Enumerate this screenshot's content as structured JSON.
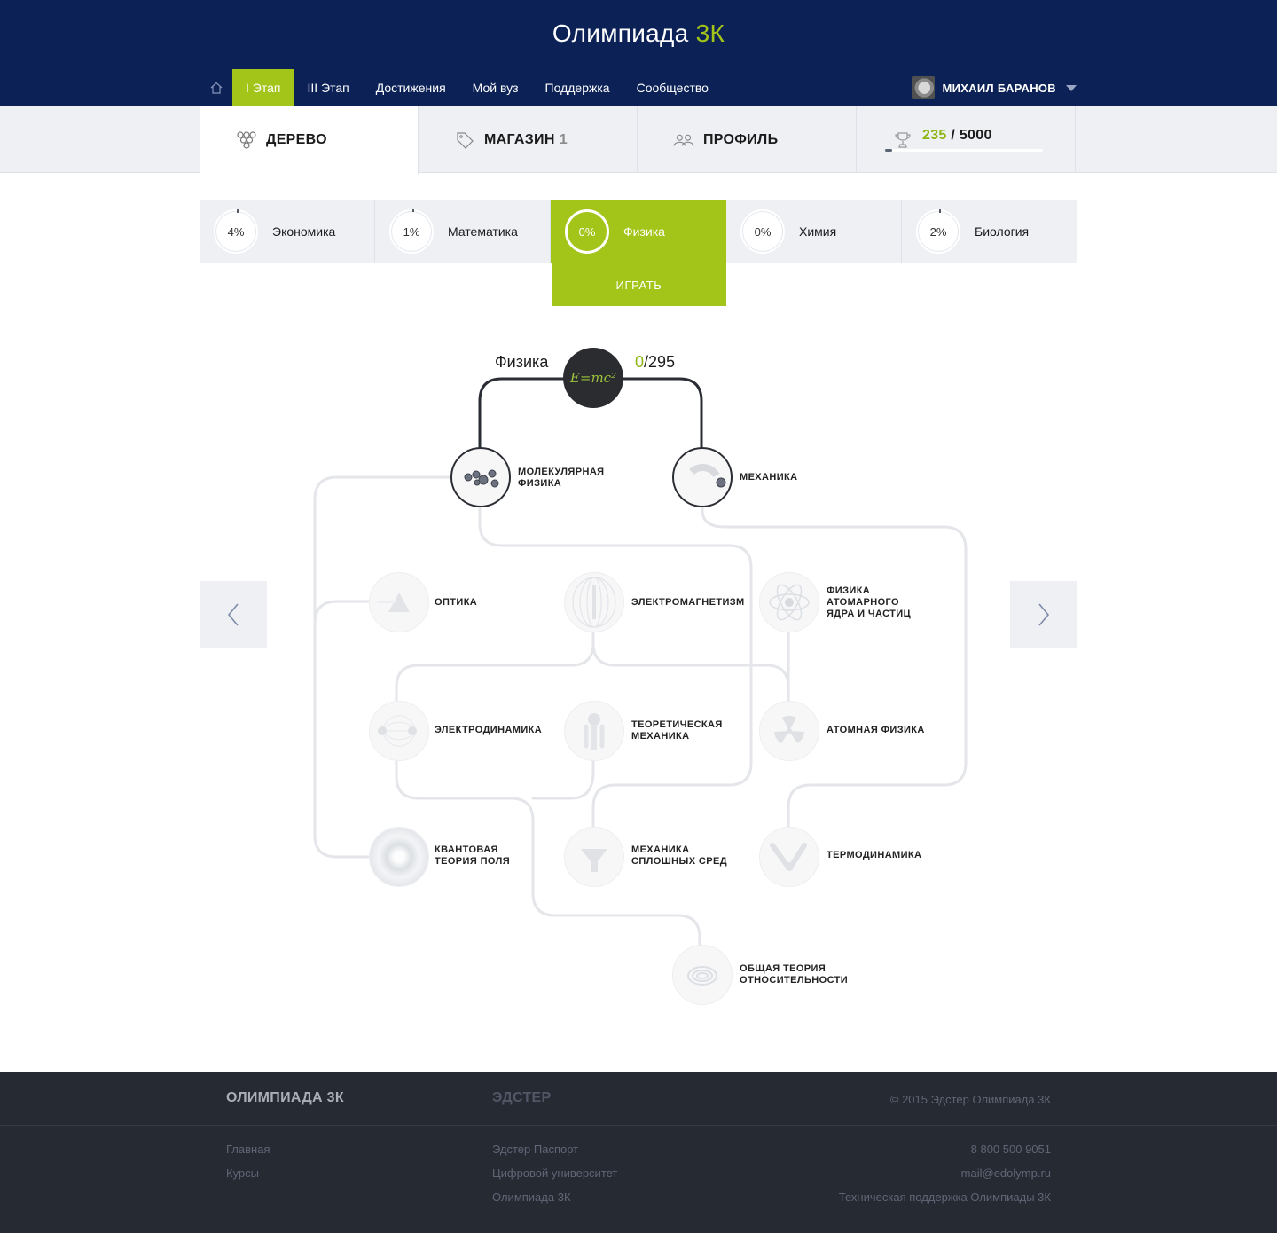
{
  "header": {
    "brand_main": "Олимпиада",
    "brand_accent": "3К",
    "nav": [
      "I Этап",
      "III Этап",
      "Достижения",
      "Мой вуз",
      "Поддержка",
      "Сообщество"
    ],
    "user_name": "МИХАИЛ БАРАНОВ"
  },
  "tabs": {
    "tree": "ДЕРЕВО",
    "shop": "МАГАЗИН",
    "shop_count": "1",
    "profile": "ПРОФИЛЬ",
    "score_current": "235",
    "score_separator": " / ",
    "score_total": "5000",
    "score_progress": 0.047
  },
  "subjects": [
    {
      "percent": "4%",
      "name": "Экономика"
    },
    {
      "percent": "1%",
      "name": "Математика"
    },
    {
      "percent": "0%",
      "name": "Физика"
    },
    {
      "percent": "0%",
      "name": "Химия"
    },
    {
      "percent": "2%",
      "name": "Биология"
    }
  ],
  "play_label": "ИГРАТЬ",
  "tree": {
    "root_title": "Физика",
    "root_icon_text": "E=mc²",
    "root_done": "0",
    "root_total": "/295",
    "nodes": [
      {
        "label": "Молекулярная физика"
      },
      {
        "label": "Механика"
      },
      {
        "label": "Оптика"
      },
      {
        "label": "Электромагнетизм"
      },
      {
        "label": "Физика атомарного ядра и частиц"
      },
      {
        "label": "Электродинамика"
      },
      {
        "label": "Теоретическая механика"
      },
      {
        "label": "Атомная физика"
      },
      {
        "label": "Квантовая теория поля"
      },
      {
        "label": "Механика сплошных сред"
      },
      {
        "label": "Термодинамика"
      },
      {
        "label": "Общая теория относительности"
      }
    ]
  },
  "footer": {
    "brand_left": "ОЛИМПИАДА 3К",
    "brand_mid": "ЭДСТЕР",
    "copyright": "© 2015 Эдстер Олимпиада 3К",
    "left_links": [
      "Главная",
      "Курсы"
    ],
    "mid_links": [
      "Эдстер Паспорт",
      "Цифровой университет",
      "Олимпиада 3К"
    ],
    "right_links": [
      "8 800 500 9051",
      "mail@edolymp.ru",
      "Техническая поддержка Олимпиады 3К"
    ]
  },
  "colors": {
    "header_bg": "#0c2257",
    "accent": "#a3c419",
    "footer_bg": "#262a33"
  }
}
